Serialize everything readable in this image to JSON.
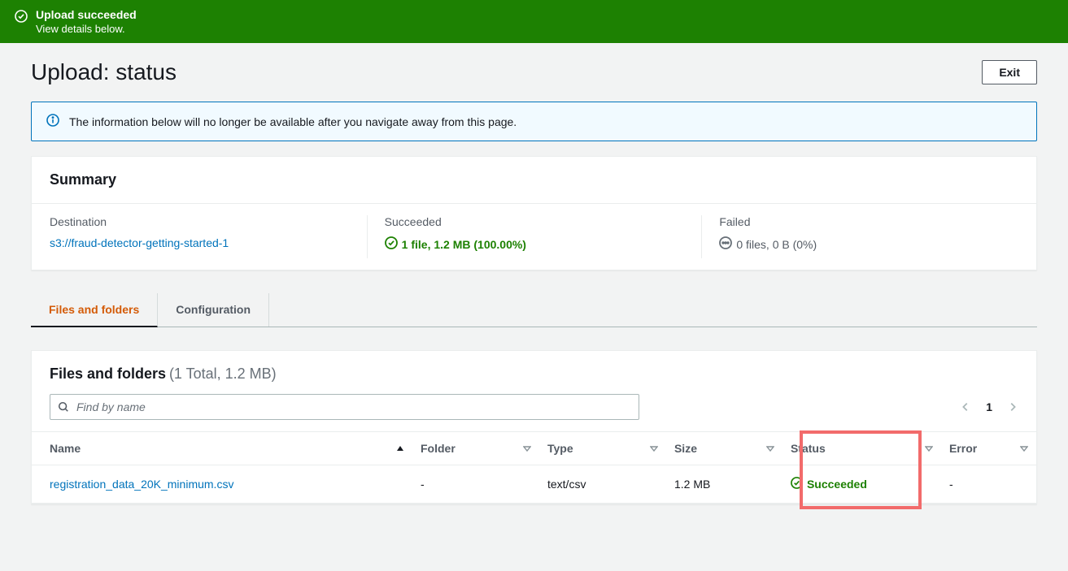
{
  "banner": {
    "title": "Upload succeeded",
    "subtitle": "View details below."
  },
  "header": {
    "title": "Upload: status",
    "exit_label": "Exit"
  },
  "info": {
    "text": "The information below will no longer be available after you navigate away from this page."
  },
  "summary": {
    "title": "Summary",
    "destination_label": "Destination",
    "destination_value": "s3://fraud-detector-getting-started-1",
    "succeeded_label": "Succeeded",
    "succeeded_value": "1 file, 1.2 MB (100.00%)",
    "failed_label": "Failed",
    "failed_value": "0 files, 0 B (0%)"
  },
  "tabs": {
    "files": "Files and folders",
    "config": "Configuration"
  },
  "files_card": {
    "title": "Files and folders",
    "subtitle": "(1 Total, 1.2 MB)",
    "search_placeholder": "Find by name",
    "page": "1",
    "columns": {
      "name": "Name",
      "folder": "Folder",
      "type": "Type",
      "size": "Size",
      "status": "Status",
      "error": "Error"
    },
    "row": {
      "name": "registration_data_20K_minimum.csv",
      "folder": "-",
      "type": "text/csv",
      "size": "1.2 MB",
      "status": "Succeeded",
      "error": "-"
    }
  }
}
